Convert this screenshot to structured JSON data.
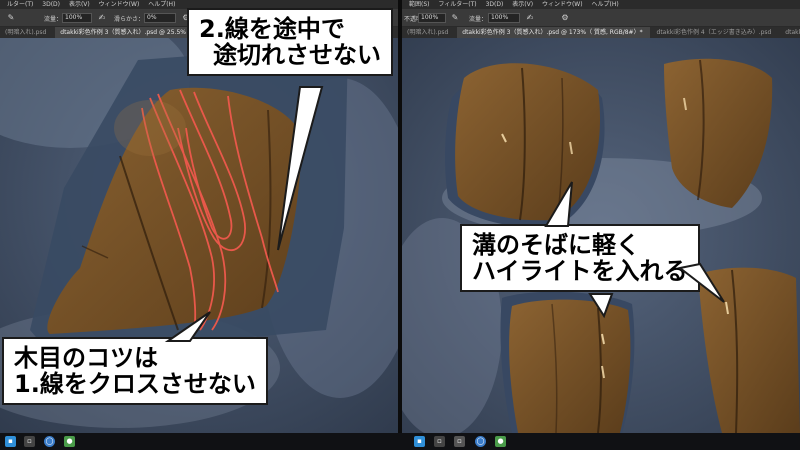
{
  "colors": {
    "background": "#3d4b61",
    "metal_rim": "#3e4f68",
    "wood": "#6b4a22",
    "wood_light": "#8a6231",
    "wood_grain_marker": "#e8584a",
    "highlight": "#f2d9a8",
    "callout_bg": "#ffffff",
    "callout_text": "#000000"
  },
  "left_window": {
    "menu": [
      "ルター(T)",
      "3D(D)",
      "表示(V)",
      "ウィンドウ(W)",
      "ヘルプ(H)"
    ],
    "options": {
      "flow_label": "流量：",
      "flow_value": "100%",
      "smoothing_label": "滑らかさ：",
      "smoothing_value": "0%"
    },
    "tabs": [
      "(明暗入れ).psd",
      "dtakki彩色作例 3（質感入れ）.psd @ 25.5%（レイヤー 43, RGB/8#）*"
    ],
    "callouts": {
      "top": [
        "2.線を途中で",
        "途切れさせない"
      ],
      "bottom": [
        "木目のコツは",
        "1.線をクロスさせない"
      ]
    }
  },
  "right_window": {
    "menu": [
      "範囲(S)",
      "フィルター(T)",
      "3D(D)",
      "表示(V)",
      "ウィンドウ(W)",
      "ヘルプ(H)"
    ],
    "options": {
      "opacity_label": "不透明度：",
      "opacity_value": "100%",
      "flow_label": "流量：",
      "flow_value": "100%"
    },
    "tabs": [
      "(明暗入れ).psd",
      "dtakki彩色作例 3（質感入れ）.psd @ 173%（ 質感, RGB/8#）*",
      "dtakki彩色作例 4（エッジ書き込み）.psd",
      "dtakki彩色作例 5（ディテール書き込み）"
    ],
    "callout": [
      "溝のそばに軽く",
      "ハイライトを入れる"
    ]
  },
  "taskbar": {
    "icons": [
      "app-icon-1",
      "app-icon-2",
      "app-icon-3",
      "app-icon-4",
      "app-icon-5"
    ]
  }
}
